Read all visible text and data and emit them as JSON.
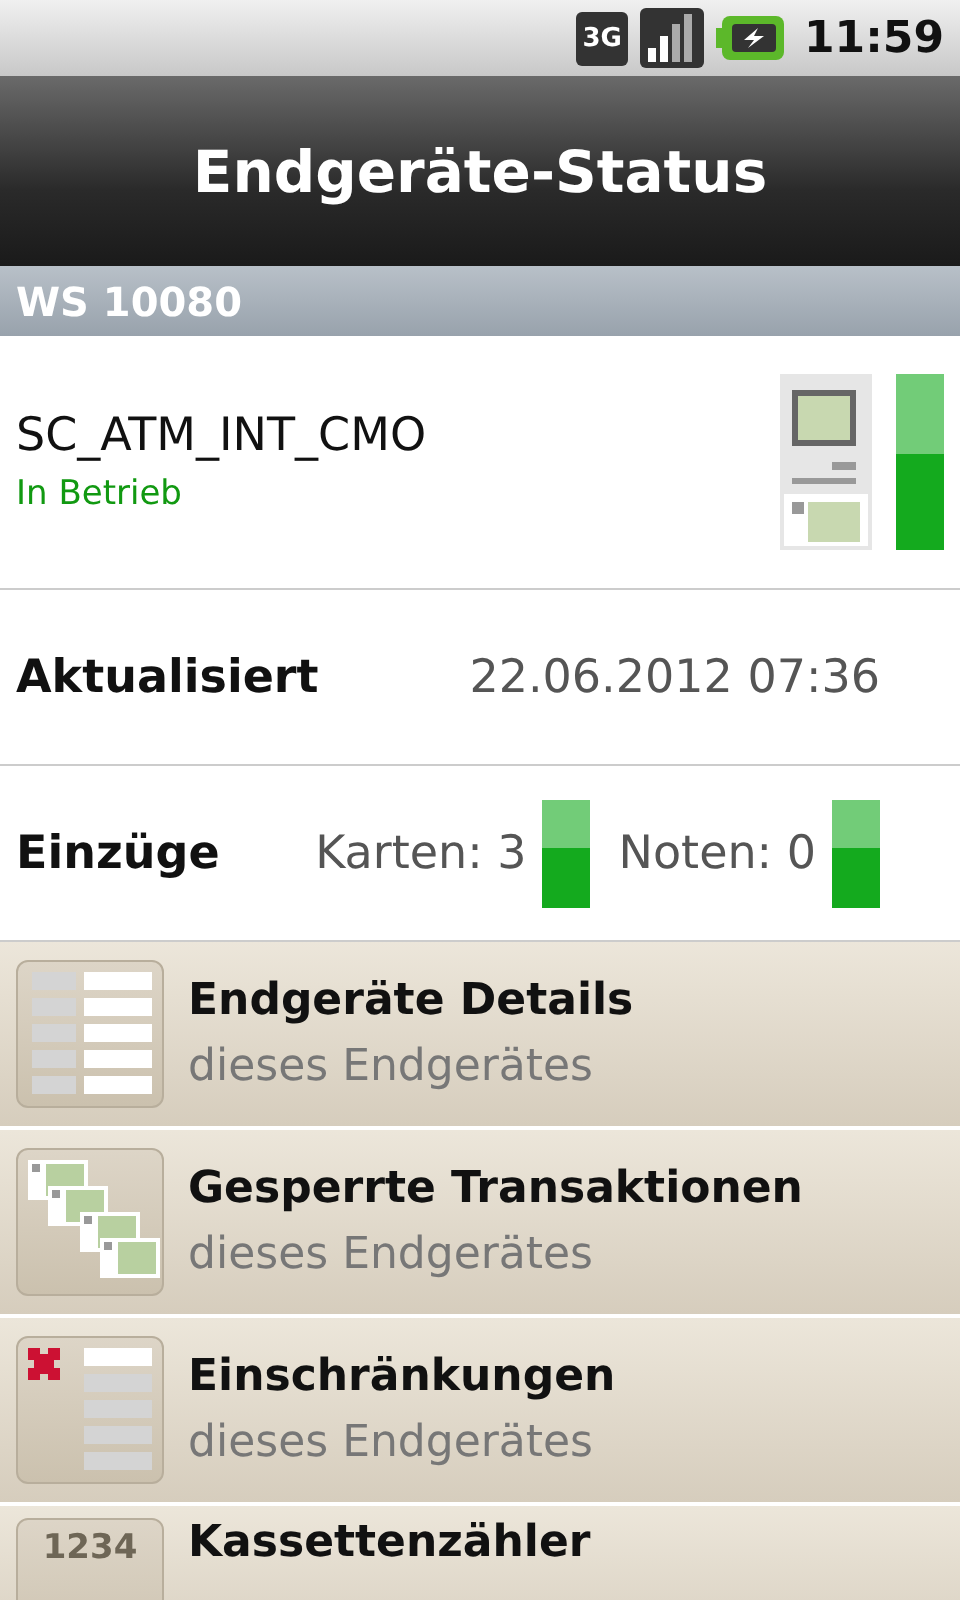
{
  "status_bar": {
    "network": "3G",
    "time": "11:59"
  },
  "header": {
    "title": "Endgeräte-Status"
  },
  "section": {
    "title": "WS 10080"
  },
  "device": {
    "name": "SC_ATM_INT_CMO",
    "status": "In Betrieb",
    "indicator": {
      "color": "#14aa1e"
    }
  },
  "updated": {
    "label": "Aktualisiert",
    "value": "22.06.2012 07:36"
  },
  "intakes": {
    "label": "Einzüge",
    "items": [
      {
        "label": "Karten: 3",
        "color": "#14aa1e"
      },
      {
        "label": "Noten: 0",
        "color": "#14aa1e"
      }
    ]
  },
  "menu": [
    {
      "kind": "details",
      "title": "Endgeräte Details",
      "subtitle": "dieses Endgerätes"
    },
    {
      "kind": "transactions",
      "title": "Gesperrte Transaktionen",
      "subtitle": "dieses Endgerätes"
    },
    {
      "kind": "restrictions",
      "title": "Einschränkungen",
      "subtitle": "dieses Endgerätes"
    },
    {
      "kind": "counter",
      "title": "Kassettenzähler",
      "icon_text": "1234"
    }
  ]
}
